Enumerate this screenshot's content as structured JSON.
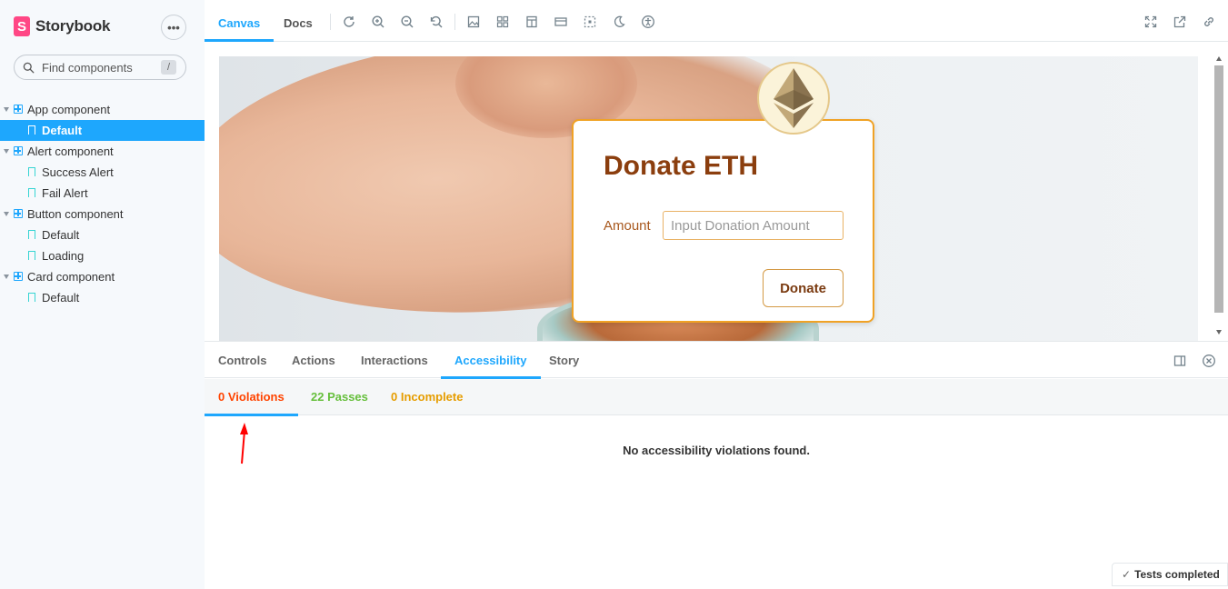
{
  "brand": {
    "name": "Storybook",
    "logo_letter": "S",
    "menu_glyph": "•••"
  },
  "search": {
    "placeholder": "Find components",
    "shortcut": "/"
  },
  "tree": [
    {
      "type": "group",
      "label": "App component"
    },
    {
      "type": "story",
      "label": "Default",
      "selected": true
    },
    {
      "type": "group",
      "label": "Alert component"
    },
    {
      "type": "story",
      "label": "Success Alert"
    },
    {
      "type": "story",
      "label": "Fail Alert"
    },
    {
      "type": "group",
      "label": "Button component"
    },
    {
      "type": "story",
      "label": "Default"
    },
    {
      "type": "story",
      "label": "Loading"
    },
    {
      "type": "group",
      "label": "Card component"
    },
    {
      "type": "story",
      "label": "Default"
    }
  ],
  "toolbar": {
    "tabs": [
      "Canvas",
      "Docs"
    ],
    "active_tab": "Canvas",
    "tools": [
      "reload-icon",
      "zoom-in-icon",
      "zoom-out-icon",
      "zoom-reset-icon",
      "background-icon",
      "grid-icon",
      "viewport-icon",
      "measure-icon",
      "outline-icon",
      "theme-moon-icon",
      "accessibility-icon"
    ],
    "right_tools": [
      "fullscreen-icon",
      "open-new-tab-icon",
      "copy-link-icon"
    ]
  },
  "preview": {
    "title": "Donate ETH",
    "amount_label": "Amount",
    "amount_placeholder": "Input Donation Amount",
    "button_label": "Donate"
  },
  "panel": {
    "tabs": [
      "Controls",
      "Actions",
      "Interactions",
      "Accessibility",
      "Story"
    ],
    "active_tab": "Accessibility",
    "subtabs": {
      "violations": "0 Violations",
      "passes": "22 Passes",
      "incomplete": "0 Incomplete"
    },
    "message": "No accessibility violations found.",
    "status": "Tests completed"
  },
  "colors": {
    "accent": "#1ea7fd",
    "violations": "#ff4400",
    "passes": "#66bf3c",
    "incomplete": "#e69d00",
    "annotation_arrow": "#ff0000",
    "brand": "#ff4785",
    "donate_title": "#8b3e0e"
  }
}
